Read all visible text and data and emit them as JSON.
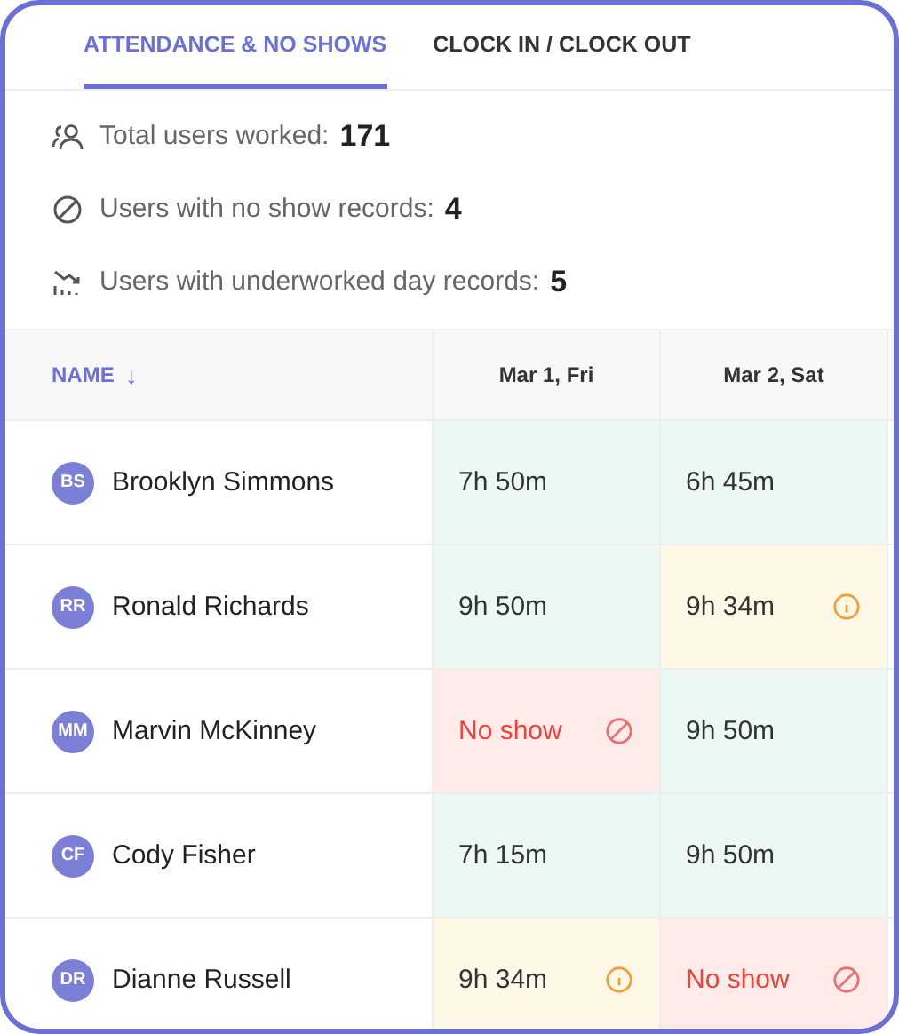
{
  "tabs": [
    {
      "label": "ATTENDANCE & NO SHOWS",
      "selected": true
    },
    {
      "label": "CLOCK IN / CLOCK OUT",
      "selected": false
    }
  ],
  "stats": [
    {
      "kind": "users",
      "label": "Total users worked:",
      "value": "171"
    },
    {
      "kind": "noshow",
      "label": "Users with no show records:",
      "value": "4"
    },
    {
      "kind": "underworked",
      "label": "Users with underworked day records:",
      "value": "5"
    }
  ],
  "table": {
    "columns": [
      {
        "label": "NAME",
        "sort": "↓"
      },
      {
        "label": "Mar 1, Fri"
      },
      {
        "label": "Mar 2, Sat"
      }
    ],
    "rows": [
      {
        "initials": "BS",
        "name": "Brooklyn Simmons",
        "cells": [
          {
            "kind": "ok",
            "text": "7h 50m"
          },
          {
            "kind": "ok",
            "text": "6h 45m"
          }
        ]
      },
      {
        "initials": "RR",
        "name": "Ronald Richards",
        "cells": [
          {
            "kind": "ok",
            "text": "9h 50m"
          },
          {
            "kind": "under",
            "text": "9h 34m"
          }
        ]
      },
      {
        "initials": "MM",
        "name": "Marvin McKinney",
        "cells": [
          {
            "kind": "noshow",
            "text": "No show"
          },
          {
            "kind": "ok",
            "text": "9h 50m"
          }
        ]
      },
      {
        "initials": "CF",
        "name": "Cody Fisher",
        "cells": [
          {
            "kind": "ok",
            "text": "7h 15m"
          },
          {
            "kind": "ok",
            "text": "9h 50m"
          }
        ]
      },
      {
        "initials": "DR",
        "name": "Dianne Russell",
        "cells": [
          {
            "kind": "under",
            "text": "9h 34m"
          },
          {
            "kind": "noshow",
            "text": "No show"
          }
        ]
      }
    ]
  }
}
